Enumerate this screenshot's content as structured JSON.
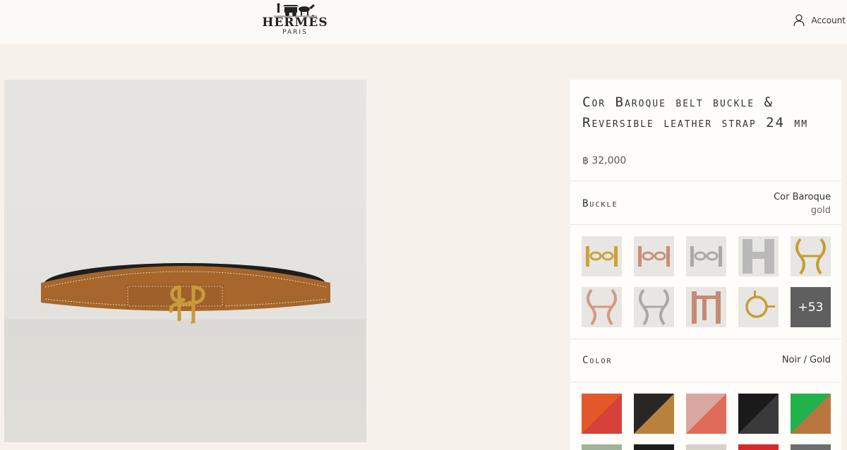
{
  "brand": {
    "name": "HERMÈS",
    "city": "PARIS"
  },
  "header": {
    "account_label": "Account"
  },
  "product": {
    "title": "Cor Baroque belt buckle & Reversible leather strap 24 mm",
    "price": "฿ 32,000"
  },
  "buckle": {
    "label": "Buckle",
    "selected_name": "Cor Baroque",
    "selected_finish": "gold",
    "more_count": "+53",
    "options": [
      {
        "name": "chaine-gold",
        "color": "#c9a23c"
      },
      {
        "name": "chaine-rose",
        "color": "#c88f78"
      },
      {
        "name": "chaine-silver",
        "color": "#a8a8a8"
      },
      {
        "name": "h-guilloche-silver",
        "color": "#b9b9b9"
      },
      {
        "name": "cor-baroque-gold",
        "color": "#c79c33"
      },
      {
        "name": "cor-baroque-rose",
        "color": "#d29a86"
      },
      {
        "name": "cor-baroque-silver",
        "color": "#a9a9a9"
      },
      {
        "name": "h-twisted-rose",
        "color": "#c58a74"
      },
      {
        "name": "ring-gold",
        "color": "#c99d36"
      }
    ]
  },
  "color": {
    "label": "Color",
    "selected": "Noir / Gold",
    "options": [
      {
        "name": "orange-red-print",
        "a": "#e4572a",
        "b": "#d8403a"
      },
      {
        "name": "black-shell-gold",
        "a": "#2a2623",
        "b": "#b8823e"
      },
      {
        "name": "rose-print",
        "a": "#d9a7a0",
        "b": "#e06b5a"
      },
      {
        "name": "black-croco",
        "a": "#1a1a1a",
        "b": "#3a3a3a"
      },
      {
        "name": "green-gold",
        "a": "#22b24c",
        "b": "#b9773f"
      }
    ]
  },
  "colors": {
    "header_bg": "#fcfaf7",
    "page_bg": "#f6f1eb",
    "panel_bg": "#fffdf9",
    "leather": "#a7662b"
  }
}
